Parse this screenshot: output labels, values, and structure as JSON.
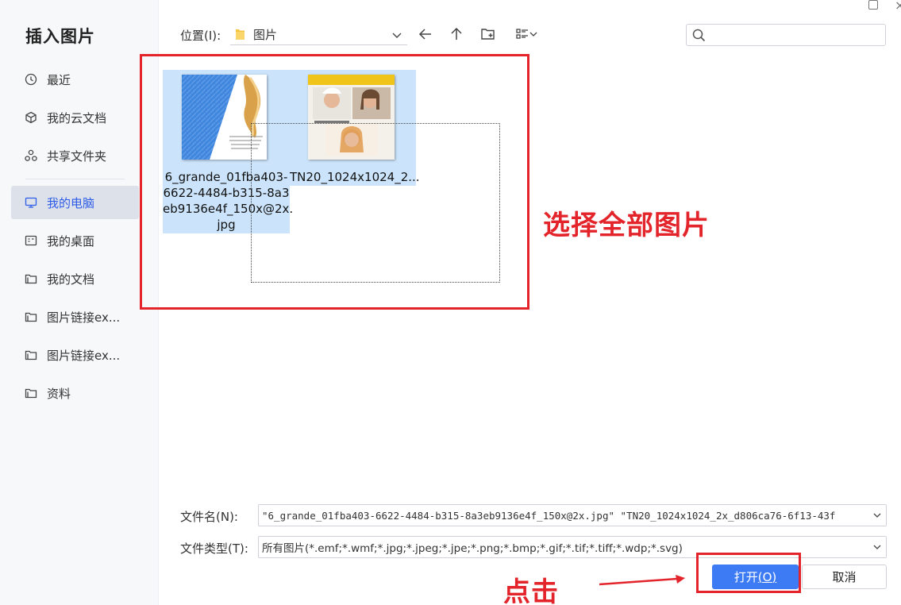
{
  "dialog": {
    "title": "插入图片"
  },
  "sidebar": {
    "items": [
      {
        "label": "最近",
        "icon": "clock-icon"
      },
      {
        "label": "我的云文档",
        "icon": "cloud-doc-icon"
      },
      {
        "label": "共享文件夹",
        "icon": "share-folder-icon"
      },
      {
        "label": "我的电脑",
        "icon": "computer-icon",
        "active": true
      },
      {
        "label": "我的桌面",
        "icon": "desktop-icon"
      },
      {
        "label": "我的文档",
        "icon": "folder-icon"
      },
      {
        "label": "图片链接ex...",
        "icon": "folder-icon"
      },
      {
        "label": "图片链接ex...",
        "icon": "folder-icon"
      },
      {
        "label": "资料",
        "icon": "folder-icon"
      }
    ]
  },
  "toolbar": {
    "location_label": "位置(I):",
    "location_value": "图片",
    "search_placeholder": ""
  },
  "files": [
    {
      "name_lines": [
        "6_grande_01fba403-",
        "6622-4484-b315-8a3",
        "eb9136e4f_150x@2x.",
        "jpg"
      ],
      "selected": true
    },
    {
      "name_lines": [
        "TN20_1024x1024_2..."
      ],
      "selected": true
    }
  ],
  "form": {
    "filename_label": "文件名(N):",
    "filename_value": "\"6_grande_01fba403-6622-4484-b315-8a3eb9136e4f_150x@2x.jpg\" \"TN20_1024x1024_2x_d806ca76-6f13-43f",
    "filetype_label": "文件类型(T):",
    "filetype_value": "所有图片(*.emf;*.wmf;*.jpg;*.jpeg;*.jpe;*.png;*.bmp;*.gif;*.tif;*.tiff;*.wdp;*.svg)",
    "open_label": "打开",
    "open_hotkey": "(O)",
    "cancel_label": "取消"
  },
  "annotations": {
    "select_all": "选择全部图片",
    "click": "点击"
  },
  "colors": {
    "accent": "#3d7bf5",
    "annotation_red": "#e3242b",
    "selection": "#cce4fb",
    "active_nav": "#dde1ea"
  }
}
